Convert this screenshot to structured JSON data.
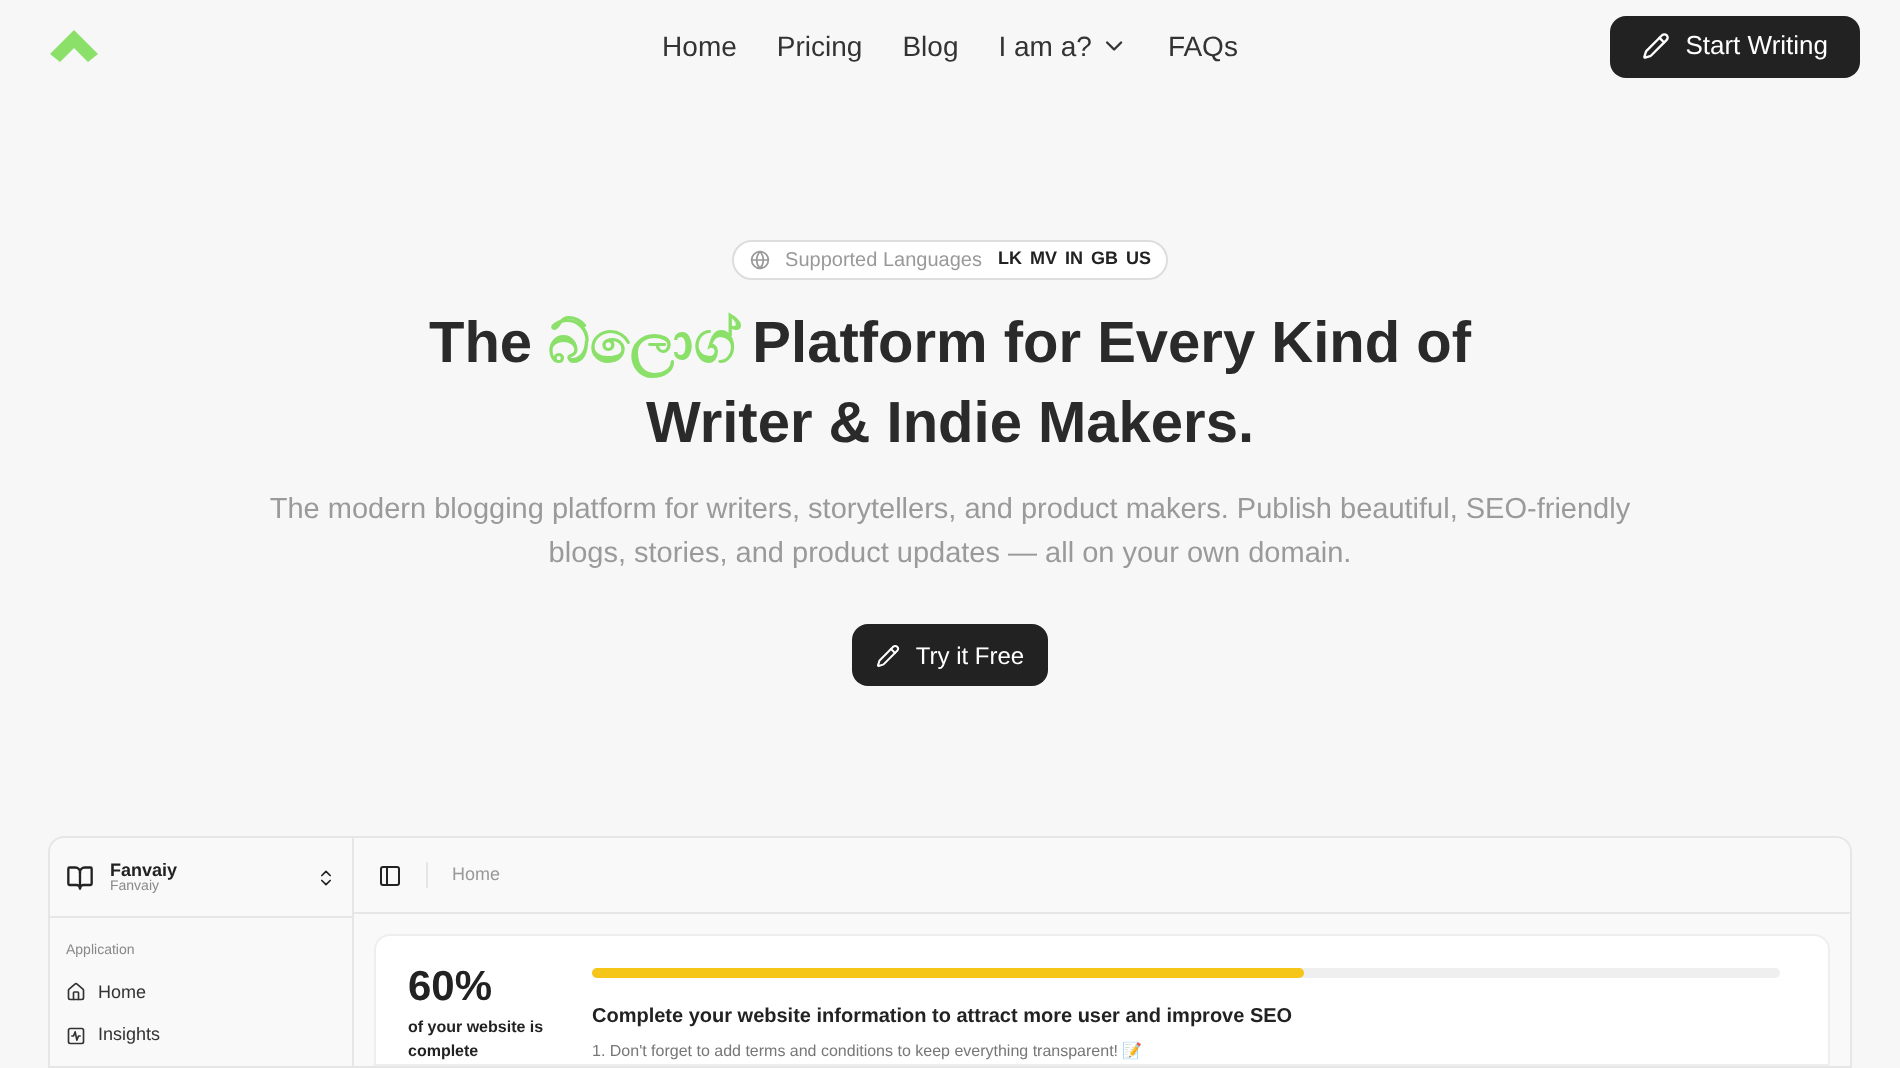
{
  "nav": {
    "links": [
      {
        "label": "Home"
      },
      {
        "label": "Pricing"
      },
      {
        "label": "Blog"
      },
      {
        "label": "I am a?",
        "dropdown": true
      },
      {
        "label": "FAQs"
      }
    ],
    "cta": "Start Writing"
  },
  "hero": {
    "languages_label": "Supported Languages",
    "languages": [
      "LK",
      "MV",
      "IN",
      "GB",
      "US"
    ],
    "title_before": "The",
    "title_highlight": "බ්ලොග්",
    "title_after": "Platform for Every Kind of Writer & Indie Makers.",
    "subtitle": "The modern blogging platform for writers, storytellers, and product makers. Publish beautiful, SEO-friendly blogs, stories, and product updates — all on your own domain.",
    "cta": "Try it Free"
  },
  "preview": {
    "workspace": {
      "name": "Fanvaiy",
      "subtitle": "Fanvaiy"
    },
    "breadcrumb": "Home",
    "sidebar": {
      "group": "Application",
      "items": [
        {
          "label": "Home"
        },
        {
          "label": "Insights"
        }
      ]
    },
    "progress": {
      "percent": "60%",
      "caption": "of your website is complete",
      "level": 0.6,
      "heading": "Complete your website information to attract more user and improve SEO",
      "tip": "1. Don't forget to add terms and conditions to keep everything transparent! 📝"
    }
  }
}
